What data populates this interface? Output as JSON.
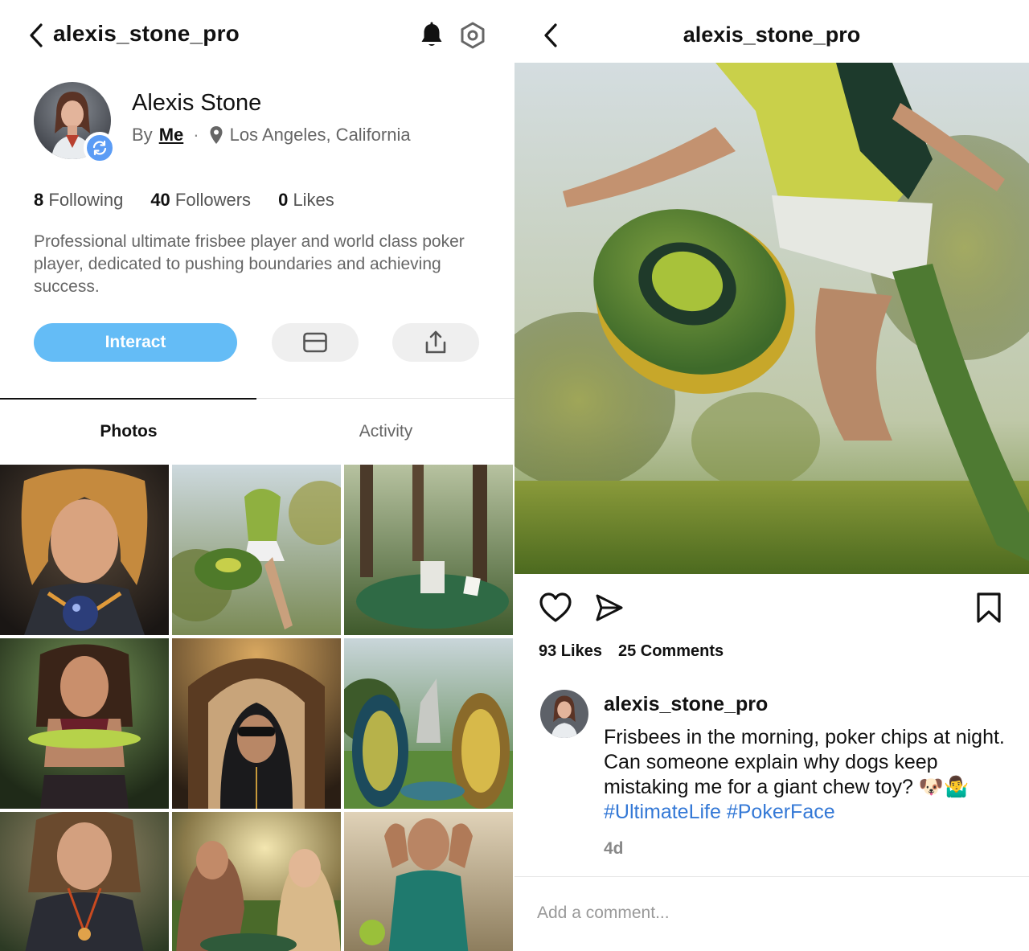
{
  "profile": {
    "username": "alexis_stone_pro",
    "display_name": "Alexis Stone",
    "by_prefix": "By",
    "by_link": "Me",
    "separator": "·",
    "location": "Los Angeles, California",
    "stats": {
      "following_count": "8",
      "following_label": "Following",
      "followers_count": "40",
      "followers_label": "Followers",
      "likes_count": "0",
      "likes_label": "Likes"
    },
    "bio": "Professional ultimate frisbee player and world class poker player, dedicated to pushing boundaries and achieving success.",
    "interact_label": "Interact",
    "tabs": [
      {
        "label": "Photos",
        "active": true
      },
      {
        "label": "Activity",
        "active": false
      }
    ],
    "grid_photos": [
      "portrait with glowing ball",
      "frisbee leap",
      "poker table in forest",
      "woman with green frisbee",
      "hooded figure in hall",
      "giant poker chips in park",
      "woman with medal",
      "two women playing cards at sunset",
      "athlete stretching"
    ]
  },
  "post": {
    "title": "alexis_stone_pro",
    "likes": "93 Likes",
    "comments": "25 Comments",
    "caption_user": "alexis_stone_pro",
    "caption_text": "Frisbees in the morning, poker chips at night. Can someone explain why dogs keep mistaking me for a giant chew toy? 🐶🤷‍♂️",
    "hashtags": "#UltimateLife #PokerFace",
    "time_ago": "4d",
    "comment_placeholder": "Add a comment..."
  },
  "colors": {
    "interact_button": "#64bcf6",
    "hashtag": "#3378d6",
    "badge": "#5b9cf5",
    "pill_bg": "#efefef"
  },
  "icons": [
    "back-chevron-icon",
    "bell-icon",
    "settings-icon",
    "sync-icon",
    "location-pin-icon",
    "mail-icon",
    "share-icon",
    "heart-icon",
    "send-icon",
    "bookmark-icon"
  ]
}
